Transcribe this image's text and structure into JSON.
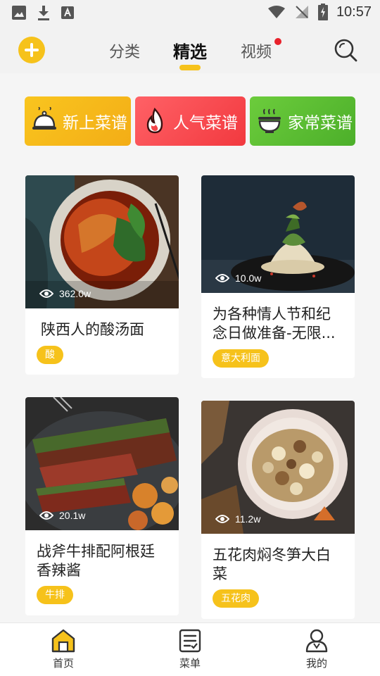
{
  "status_bar": {
    "time": "10:57"
  },
  "top_nav": {
    "tabs": [
      {
        "label": "分类"
      },
      {
        "label": "精选",
        "active": true
      },
      {
        "label": "视频",
        "badge": true
      }
    ]
  },
  "categories": [
    {
      "label": "新上菜谱",
      "icon": "cloche-icon",
      "color": "#f6b91b"
    },
    {
      "label": "人气菜谱",
      "icon": "flame-icon",
      "color": "#f4464b"
    },
    {
      "label": "家常菜谱",
      "icon": "bowl-icon",
      "color": "#5bbd33"
    }
  ],
  "recipes": [
    {
      "title": "陕西人的酸汤面",
      "views": "362.0w",
      "tag": "酸"
    },
    {
      "title": "为各种情人节和纪念日做准备-无限...",
      "views": "10.0w",
      "tag": "意大利面"
    },
    {
      "title": "战斧牛排配阿根廷香辣酱",
      "views": "20.1w",
      "tag": "牛排"
    },
    {
      "title": "五花肉焖冬笋大白菜",
      "views": "11.2w",
      "tag": "五花肉"
    }
  ],
  "bottom_nav": [
    {
      "label": "首页",
      "icon": "home-icon",
      "active": true
    },
    {
      "label": "菜单",
      "icon": "menu-list-icon"
    },
    {
      "label": "我的",
      "icon": "profile-icon"
    }
  ],
  "accent_color": "#f6c21b"
}
